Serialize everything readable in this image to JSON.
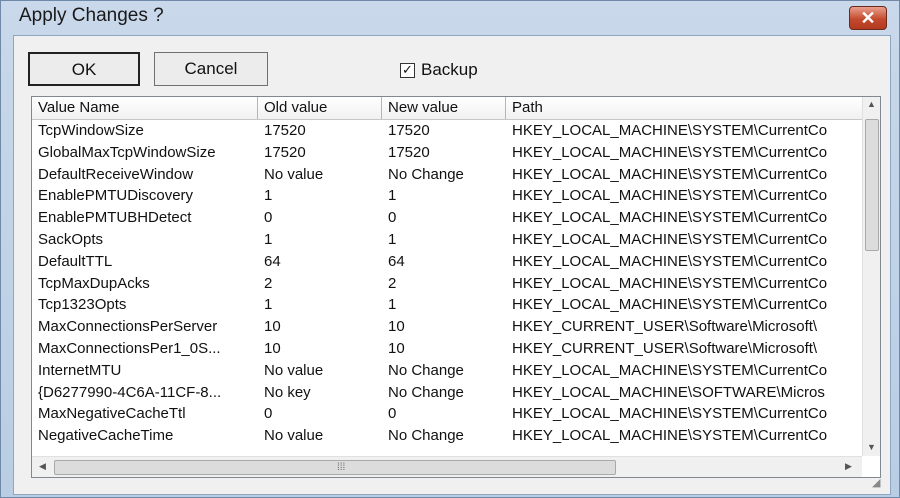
{
  "window": {
    "title": "Apply Changes ?",
    "close_label": "✕"
  },
  "toolbar": {
    "ok_label": "OK",
    "cancel_label": "Cancel",
    "backup_label": "Backup",
    "backup_checked": true
  },
  "list": {
    "columns": [
      "Value Name",
      "Old value",
      "New value",
      "Path"
    ],
    "rows": [
      [
        "TcpWindowSize",
        "17520",
        "17520",
        "HKEY_LOCAL_MACHINE\\SYSTEM\\CurrentCo"
      ],
      [
        "GlobalMaxTcpWindowSize",
        "17520",
        "17520",
        "HKEY_LOCAL_MACHINE\\SYSTEM\\CurrentCo"
      ],
      [
        "DefaultReceiveWindow",
        "No value",
        "No Change",
        "HKEY_LOCAL_MACHINE\\SYSTEM\\CurrentCo"
      ],
      [
        "EnablePMTUDiscovery",
        "1",
        "1",
        "HKEY_LOCAL_MACHINE\\SYSTEM\\CurrentCo"
      ],
      [
        "EnablePMTUBHDetect",
        "0",
        "0",
        "HKEY_LOCAL_MACHINE\\SYSTEM\\CurrentCo"
      ],
      [
        "SackOpts",
        "1",
        "1",
        "HKEY_LOCAL_MACHINE\\SYSTEM\\CurrentCo"
      ],
      [
        "DefaultTTL",
        "64",
        "64",
        "HKEY_LOCAL_MACHINE\\SYSTEM\\CurrentCo"
      ],
      [
        "TcpMaxDupAcks",
        "2",
        "2",
        "HKEY_LOCAL_MACHINE\\SYSTEM\\CurrentCo"
      ],
      [
        "Tcp1323Opts",
        "1",
        "1",
        "HKEY_LOCAL_MACHINE\\SYSTEM\\CurrentCo"
      ],
      [
        "MaxConnectionsPerServer",
        "10",
        "10",
        "HKEY_CURRENT_USER\\Software\\Microsoft\\"
      ],
      [
        "MaxConnectionsPer1_0S...",
        "10",
        "10",
        "HKEY_CURRENT_USER\\Software\\Microsoft\\"
      ],
      [
        "InternetMTU",
        "No value",
        "No Change",
        "HKEY_LOCAL_MACHINE\\SYSTEM\\CurrentCo"
      ],
      [
        "{D6277990-4C6A-11CF-8...",
        "No key",
        "No Change",
        "HKEY_LOCAL_MACHINE\\SOFTWARE\\Micros"
      ],
      [
        "MaxNegativeCacheTtl",
        "0",
        "0",
        "HKEY_LOCAL_MACHINE\\SYSTEM\\CurrentCo"
      ],
      [
        "NegativeCacheTime",
        "No value",
        "No Change",
        "HKEY_LOCAL_MACHINE\\SYSTEM\\CurrentCo"
      ]
    ]
  }
}
